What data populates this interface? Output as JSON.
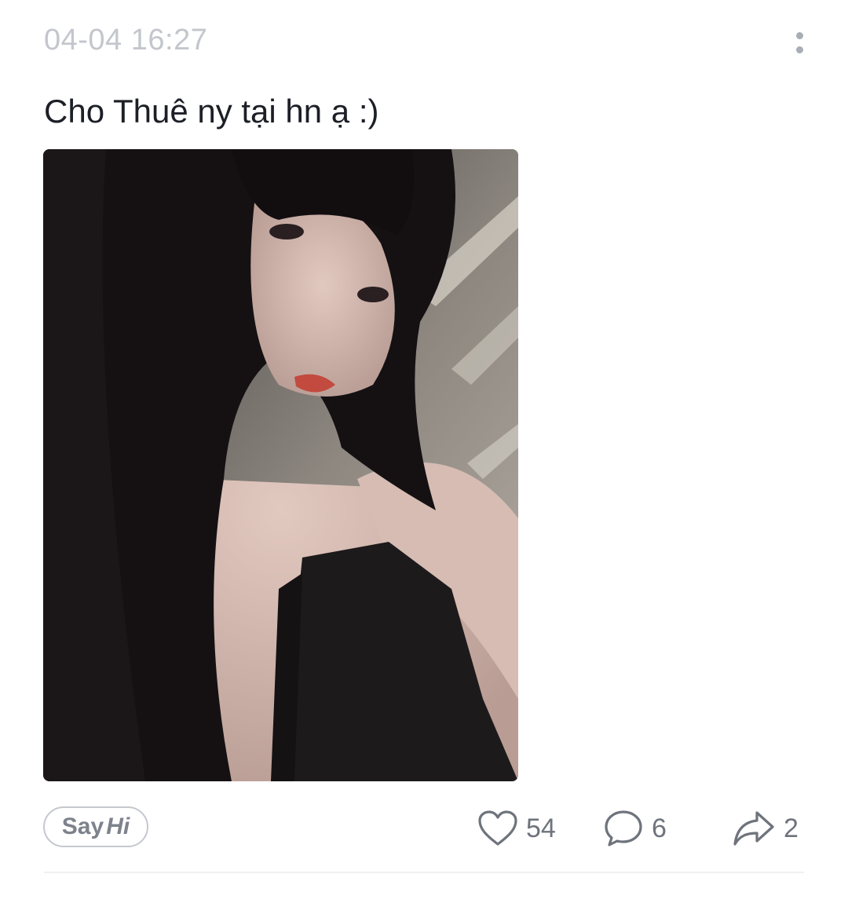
{
  "post": {
    "timestamp": "04-04 16:27",
    "text": "Cho Thuê ny tại hn ạ :)",
    "more_icon": "more-vertical-icon",
    "photo_icon": "photo"
  },
  "actions": {
    "say": "Say",
    "hi": "Hi",
    "likes": "54",
    "comments": "6",
    "shares": "2",
    "like_icon": "heart-icon",
    "comment_icon": "comment-bubble-icon",
    "share_icon": "share-arrow-icon"
  },
  "colors": {
    "timestamp": "#c3c6cc",
    "text": "#1c1f26",
    "icon": "#6e737c",
    "divider": "#eef0f3"
  }
}
